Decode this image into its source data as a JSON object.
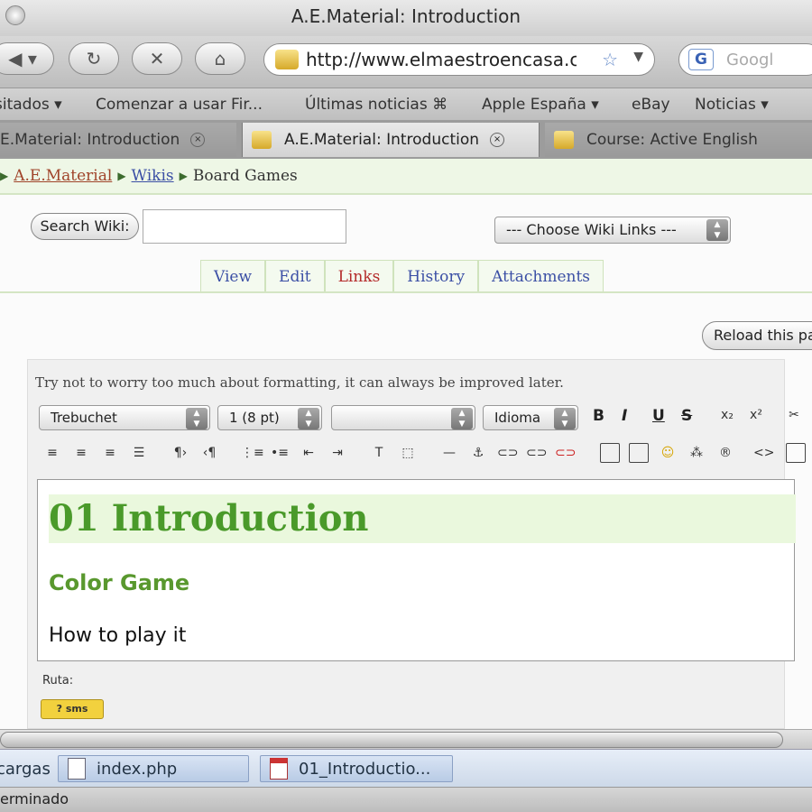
{
  "window": {
    "title": "A.E.Material: Introduction"
  },
  "nav": {
    "back_icon": "back-arrow",
    "reload_icon": "reload",
    "stop_icon": "stop",
    "home_icon": "home",
    "url": "http://www.elmaestroencasa.co",
    "search_placeholder": "Googl"
  },
  "bookmarks": [
    "sitados ▾",
    "Comenzar a usar Fir...",
    "Últimas noticias ⌘",
    "Apple España ▾",
    "eBay",
    "Noticias ▾"
  ],
  "tabs": [
    {
      "label": "E.Material: Introduction",
      "active": false
    },
    {
      "label": "A.E.Material: Introduction",
      "active": true
    },
    {
      "label": "Course: Active English",
      "active": false
    }
  ],
  "breadcrumb": {
    "root": "A.E.Material",
    "wikis": "Wikis",
    "current": "Board Games"
  },
  "wiki": {
    "search_button": "Search Wiki:",
    "links_select": "--- Choose Wiki Links ---",
    "tabs": [
      "View",
      "Edit",
      "Links",
      "History",
      "Attachments"
    ],
    "active_tab": "Links",
    "reload_button": "Reload this pa"
  },
  "editor": {
    "hint": "Try not to worry too much about formatting, it can always be improved later.",
    "font_select": "Trebuchet",
    "size_select": "1 (8 pt)",
    "format_select": "",
    "lang_select": "Idioma",
    "toolbar_bold": "B",
    "toolbar_italic": "I",
    "toolbar_underline": "U",
    "toolbar_strike": "S",
    "heading1": "01 Introduction",
    "heading2": "Color Game",
    "paragraph": "How to play it",
    "path_label": "Ruta:",
    "badge": "? sms"
  },
  "downloads": {
    "label": "cargas",
    "items": [
      "index.php",
      "01_Introductio..."
    ]
  },
  "status": {
    "text": "erminado"
  }
}
